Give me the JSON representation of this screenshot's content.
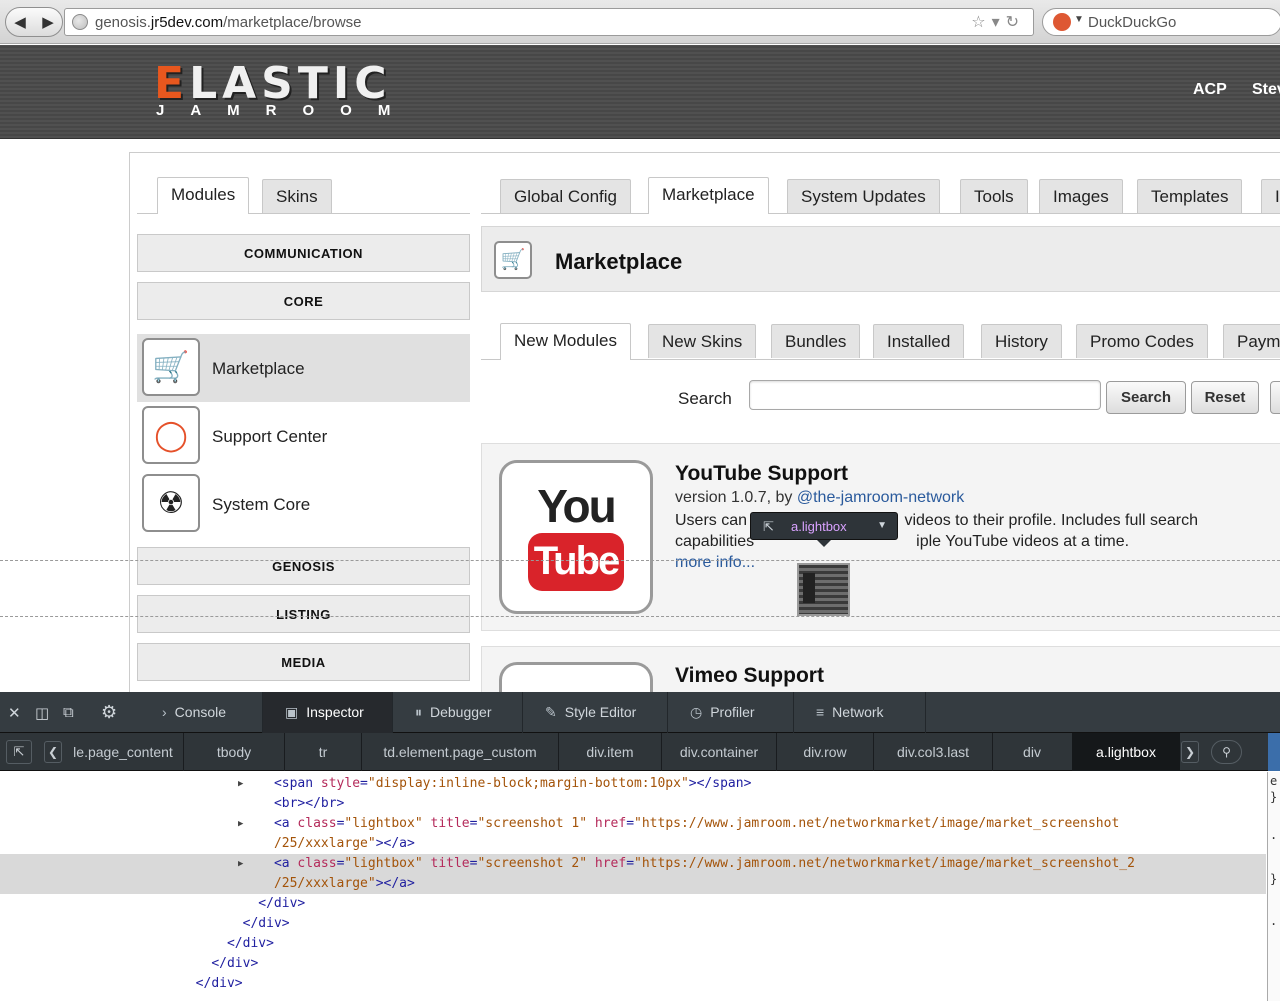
{
  "browser": {
    "url_prefix": "genosis.",
    "url_domain": "jr5dev.com",
    "url_path": "/marketplace/browse",
    "search_engine": "DuckDuckGo"
  },
  "header": {
    "logo_main": "ELASTIC",
    "logo_sub": "JAMROOM",
    "links": [
      "ACP",
      "Stev"
    ]
  },
  "tabs": {
    "left": [
      "Modules",
      "Skins"
    ],
    "right": [
      "Global Config",
      "Marketplace",
      "System Updates",
      "Tools",
      "Images",
      "Templates",
      "I"
    ]
  },
  "sidebar": {
    "categories_top": [
      "COMMUNICATION",
      "CORE"
    ],
    "modules": [
      {
        "label": "Marketplace",
        "icon": "cart-icon"
      },
      {
        "label": "Support Center",
        "icon": "lifebuoy-icon"
      },
      {
        "label": "System Core",
        "icon": "radiation-icon"
      }
    ],
    "categories_bottom": [
      "GENOSIS",
      "LISTING",
      "MEDIA"
    ]
  },
  "marketplace": {
    "title": "Marketplace",
    "subtabs": [
      "New Modules",
      "New Skins",
      "Bundles",
      "Installed",
      "History",
      "Promo Codes",
      "Paym"
    ],
    "search_label": "Search",
    "search_placeholder": "",
    "search_button": "Search",
    "reset_button": "Reset"
  },
  "items": [
    {
      "logo_top": "You",
      "logo_bottom": "Tube",
      "title": "YouTube Support",
      "version": "version 1.0.7, by",
      "author": "@the-jamroom-network",
      "desc_1a": "Users can",
      "desc_1b": " videos to their profile. Includes full search",
      "desc_2a": "capabilities",
      "desc_2b": "iple YouTube videos at a time.",
      "more": "more info..."
    },
    {
      "title": "Vimeo Support"
    }
  ],
  "inspector_tooltip": {
    "label": "a.lightbox"
  },
  "devtools": {
    "tabs": [
      "Console",
      "Inspector",
      "Debugger",
      "Style Editor",
      "Profiler",
      "Network"
    ],
    "breadcrumbs": [
      "le.page_content",
      "tbody",
      "tr",
      "td.element.page_custom",
      "div.item",
      "div.container",
      "div.row",
      "div.col3.last",
      "div",
      "a.lightbox"
    ],
    "code": {
      "l1_tag": "<span ",
      "l1_attr": "style",
      "l1_eq": "=",
      "l1_val": "\"display:inline-block;margin-bottom:10px\"",
      "l1_end": "></span>",
      "l2": "<br></br>",
      "l3_tag": "<a ",
      "l3_a1": "class",
      "l3_v1": "\"lightbox\"",
      "l3_a2": "title",
      "l3_v2": "\"screenshot 1\"",
      "l3_a3": "href",
      "l3_v3": "\"https://www.jamroom.net/networkmarket/image/market_screenshot",
      "l4_val": "/25/xxxlarge\"",
      "l4_end": "></a>",
      "l5_tag": "<a ",
      "l5_a1": "class",
      "l5_v1": "\"lightbox\"",
      "l5_a2": "title",
      "l5_v2": "\"screenshot 2\"",
      "l5_a3": "href",
      "l5_v3": "\"https://www.jamroom.net/networkmarket/image/market_screenshot_2",
      "l6_val": "/25/xxxlarge\"",
      "l6_end": "></a>",
      "close_div": "</div>"
    },
    "side_chars": [
      "e",
      "}",
      ".",
      "}",
      "."
    ]
  }
}
